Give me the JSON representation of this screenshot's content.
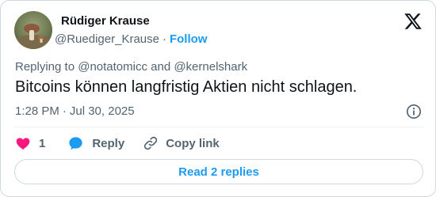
{
  "author": {
    "display_name": "Rüdiger Krause",
    "handle": "@Ruediger_Krause",
    "separator": "·",
    "follow_label": "Follow"
  },
  "reply_context": {
    "text": "Replying to @notatomicc and @kernelshark"
  },
  "tweet": {
    "text": "Bitcoins können langfristig Aktien nicht schlagen.",
    "time": "1:28 PM",
    "separator": "·",
    "date": "Jul 30, 2025"
  },
  "actions": {
    "like_count": "1",
    "reply_label": "Reply",
    "copy_link_label": "Copy link"
  },
  "read_replies_label": "Read 2 replies",
  "icons": {
    "brand": "x-logo-icon",
    "info": "info-icon",
    "like": "heart-icon",
    "reply": "speech-bubble-icon",
    "copy": "link-icon"
  },
  "colors": {
    "accent": "#1d9bf0",
    "like": "#f91880",
    "text": "#0f1419",
    "secondary": "#536471",
    "border": "#cfd9de"
  }
}
